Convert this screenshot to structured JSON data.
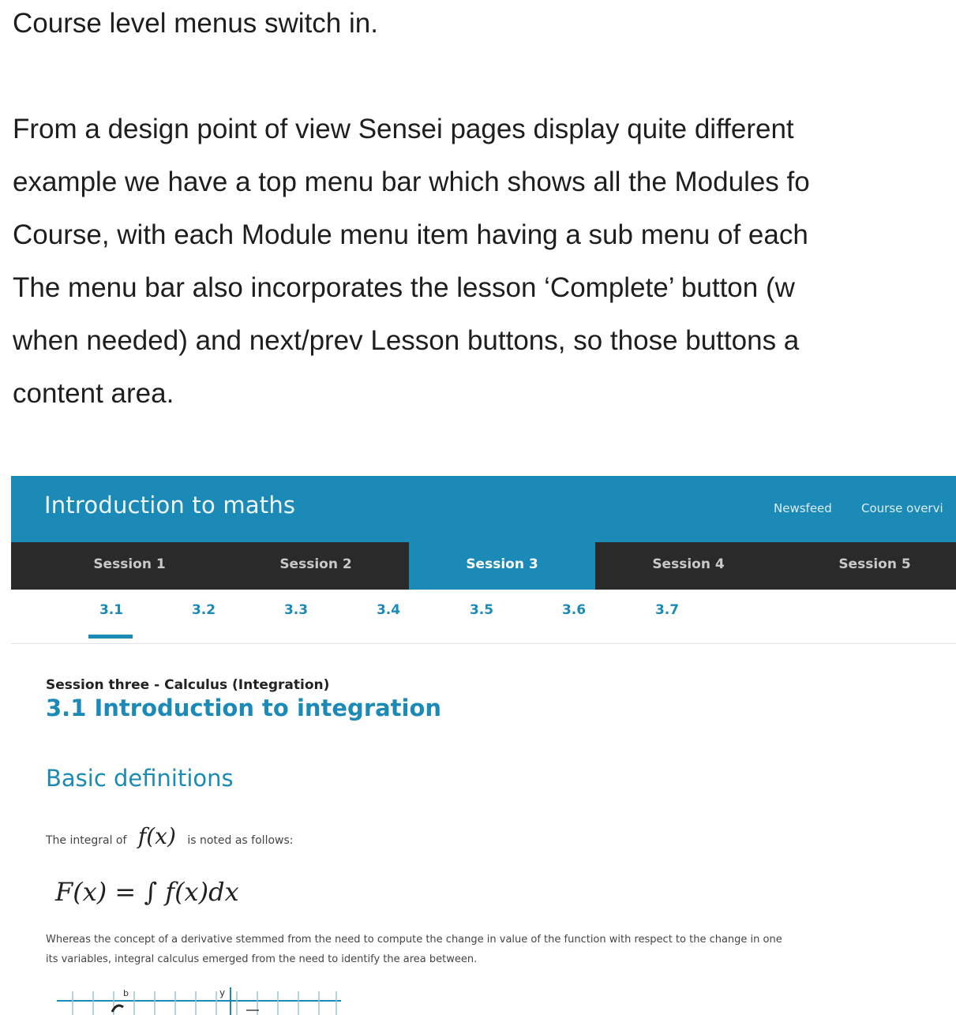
{
  "article": {
    "para1": "Course level menus switch in.",
    "para2_lines": [
      "From a design point of view Sensei pages display quite different",
      "example we have a top menu bar which shows all the Modules fo",
      "Course, with each Module menu item having a sub menu of each",
      "The menu bar also incorporates the lesson ‘Complete’ button (w",
      "when needed) and next/prev Lesson buttons, so those buttons a",
      "content area."
    ]
  },
  "screenshot": {
    "course_title": "Introduction to maths",
    "top_links": [
      "Newsfeed",
      "Course overvi"
    ],
    "sessions": [
      "Session 1",
      "Session 2",
      "Session 3",
      "Session 4",
      "Session 5"
    ],
    "active_session": "Session 3",
    "subsections": [
      "3.1",
      "3.2",
      "3.3",
      "3.4",
      "3.5",
      "3.6",
      "3.7"
    ],
    "active_subsection": "3.1",
    "kicker": "Session three - Calculus (Integration)",
    "lesson_title": "3.1 Introduction to integration",
    "heading": "Basic definitions",
    "integral_intro_before": "The integral of",
    "integral_intro_math": "f(x)",
    "integral_intro_after": "is noted as follows:",
    "formula": "F(x) = ∫ f(x)dx",
    "body_line1": "Whereas the concept of a derivative stemmed from the need to compute the change in value of the function with respect to the change in one",
    "body_line2": "its variables, integral calculus emerged from the need to identify the area between.",
    "graph_labels": {
      "axis_y": "y",
      "point": "b"
    }
  },
  "colors": {
    "accent": "#1c8ab6",
    "session_bar": "#2a2a2a"
  }
}
